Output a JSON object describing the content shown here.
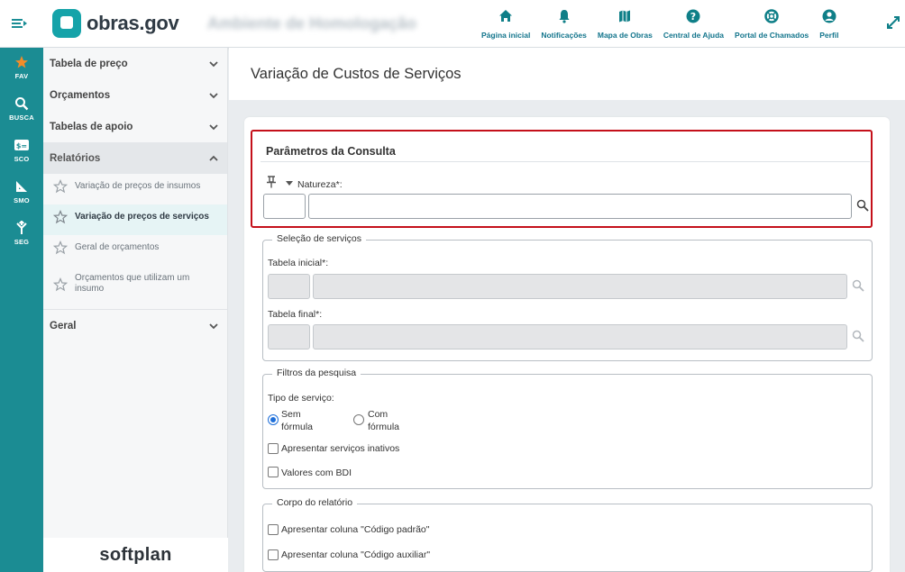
{
  "header": {
    "logo_text": "obras.gov",
    "environment": "Ambiente de Homologação",
    "nav": [
      {
        "label": "Página inicial",
        "icon": "home-icon"
      },
      {
        "label": "Notificações",
        "icon": "bell-icon"
      },
      {
        "label": "Mapa de Obras",
        "icon": "map-icon"
      },
      {
        "label": "Central de Ajuda",
        "icon": "help-icon"
      },
      {
        "label": "Portal de Chamados",
        "icon": "lifebuoy-icon"
      },
      {
        "label": "Perfil",
        "icon": "user-icon"
      }
    ]
  },
  "rail": [
    {
      "label": "FAV",
      "icon": "star-icon",
      "color": "#f28c28"
    },
    {
      "label": "BUSCA",
      "icon": "search-icon"
    },
    {
      "label": "SCO",
      "icon": "sco-icon"
    },
    {
      "label": "SMO",
      "icon": "ruler-icon"
    },
    {
      "label": "SEG",
      "icon": "merge-icon"
    }
  ],
  "sidemenu": {
    "sections": [
      {
        "label": "Tabela de preço"
      },
      {
        "label": "Orçamentos"
      },
      {
        "label": "Tabelas de apoio"
      },
      {
        "label": "Relatórios"
      },
      {
        "label": "Geral"
      }
    ],
    "reports": [
      {
        "label": "Variação de preços de insumos"
      },
      {
        "label": "Variação de preços de serviços"
      },
      {
        "label": "Geral de orçamentos"
      },
      {
        "label": "Orçamentos que utilizam um insumo"
      }
    ],
    "footer_brand": "softplan"
  },
  "page": {
    "title": "Variação de Custos de Serviços"
  },
  "params": {
    "title": "Parâmetros da Consulta",
    "natureza_label": "Natureza*:",
    "natureza_code": "",
    "natureza_desc": ""
  },
  "servicos": {
    "legend": "Seleção de serviços",
    "tabela_inicial_label": "Tabela inicial*:",
    "tabela_final_label": "Tabela final*:"
  },
  "filtros": {
    "legend": "Filtros da pesquisa",
    "tipo_label": "Tipo de serviço:",
    "radio_sem": "Sem fórmula",
    "radio_com": "Com fórmula",
    "selected": "Sem fórmula",
    "chk_inativos": "Apresentar serviços inativos",
    "chk_bdi": "Valores com BDI"
  },
  "corpo": {
    "legend": "Corpo do relatório",
    "chk_codigo_padrao": "Apresentar coluna \"Código padrão\"",
    "chk_codigo_auxiliar": "Apresentar coluna \"Código auxiliar\""
  },
  "colors": {
    "accent": "#1b8c93",
    "highlight_border": "#c4101a",
    "radio_checked": "#1e6fd9"
  }
}
